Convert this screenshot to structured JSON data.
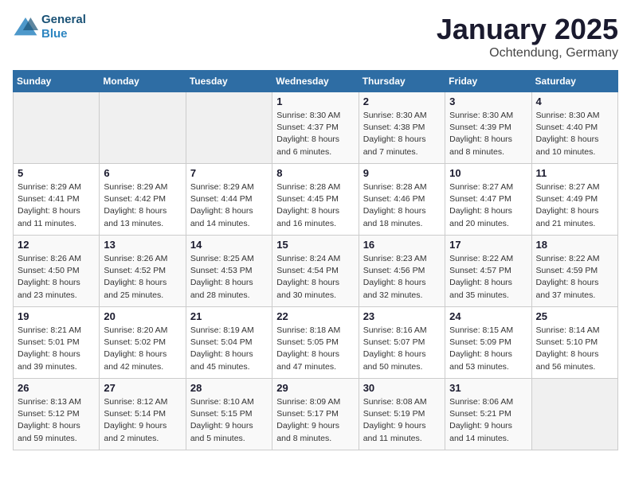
{
  "header": {
    "logo_line1": "General",
    "logo_line2": "Blue",
    "month": "January 2025",
    "location": "Ochtendung, Germany"
  },
  "weekdays": [
    "Sunday",
    "Monday",
    "Tuesday",
    "Wednesday",
    "Thursday",
    "Friday",
    "Saturday"
  ],
  "weeks": [
    [
      {
        "day": "",
        "detail": ""
      },
      {
        "day": "",
        "detail": ""
      },
      {
        "day": "",
        "detail": ""
      },
      {
        "day": "1",
        "detail": "Sunrise: 8:30 AM\nSunset: 4:37 PM\nDaylight: 8 hours\nand 6 minutes."
      },
      {
        "day": "2",
        "detail": "Sunrise: 8:30 AM\nSunset: 4:38 PM\nDaylight: 8 hours\nand 7 minutes."
      },
      {
        "day": "3",
        "detail": "Sunrise: 8:30 AM\nSunset: 4:39 PM\nDaylight: 8 hours\nand 8 minutes."
      },
      {
        "day": "4",
        "detail": "Sunrise: 8:30 AM\nSunset: 4:40 PM\nDaylight: 8 hours\nand 10 minutes."
      }
    ],
    [
      {
        "day": "5",
        "detail": "Sunrise: 8:29 AM\nSunset: 4:41 PM\nDaylight: 8 hours\nand 11 minutes."
      },
      {
        "day": "6",
        "detail": "Sunrise: 8:29 AM\nSunset: 4:42 PM\nDaylight: 8 hours\nand 13 minutes."
      },
      {
        "day": "7",
        "detail": "Sunrise: 8:29 AM\nSunset: 4:44 PM\nDaylight: 8 hours\nand 14 minutes."
      },
      {
        "day": "8",
        "detail": "Sunrise: 8:28 AM\nSunset: 4:45 PM\nDaylight: 8 hours\nand 16 minutes."
      },
      {
        "day": "9",
        "detail": "Sunrise: 8:28 AM\nSunset: 4:46 PM\nDaylight: 8 hours\nand 18 minutes."
      },
      {
        "day": "10",
        "detail": "Sunrise: 8:27 AM\nSunset: 4:47 PM\nDaylight: 8 hours\nand 20 minutes."
      },
      {
        "day": "11",
        "detail": "Sunrise: 8:27 AM\nSunset: 4:49 PM\nDaylight: 8 hours\nand 21 minutes."
      }
    ],
    [
      {
        "day": "12",
        "detail": "Sunrise: 8:26 AM\nSunset: 4:50 PM\nDaylight: 8 hours\nand 23 minutes."
      },
      {
        "day": "13",
        "detail": "Sunrise: 8:26 AM\nSunset: 4:52 PM\nDaylight: 8 hours\nand 25 minutes."
      },
      {
        "day": "14",
        "detail": "Sunrise: 8:25 AM\nSunset: 4:53 PM\nDaylight: 8 hours\nand 28 minutes."
      },
      {
        "day": "15",
        "detail": "Sunrise: 8:24 AM\nSunset: 4:54 PM\nDaylight: 8 hours\nand 30 minutes."
      },
      {
        "day": "16",
        "detail": "Sunrise: 8:23 AM\nSunset: 4:56 PM\nDaylight: 8 hours\nand 32 minutes."
      },
      {
        "day": "17",
        "detail": "Sunrise: 8:22 AM\nSunset: 4:57 PM\nDaylight: 8 hours\nand 35 minutes."
      },
      {
        "day": "18",
        "detail": "Sunrise: 8:22 AM\nSunset: 4:59 PM\nDaylight: 8 hours\nand 37 minutes."
      }
    ],
    [
      {
        "day": "19",
        "detail": "Sunrise: 8:21 AM\nSunset: 5:01 PM\nDaylight: 8 hours\nand 39 minutes."
      },
      {
        "day": "20",
        "detail": "Sunrise: 8:20 AM\nSunset: 5:02 PM\nDaylight: 8 hours\nand 42 minutes."
      },
      {
        "day": "21",
        "detail": "Sunrise: 8:19 AM\nSunset: 5:04 PM\nDaylight: 8 hours\nand 45 minutes."
      },
      {
        "day": "22",
        "detail": "Sunrise: 8:18 AM\nSunset: 5:05 PM\nDaylight: 8 hours\nand 47 minutes."
      },
      {
        "day": "23",
        "detail": "Sunrise: 8:16 AM\nSunset: 5:07 PM\nDaylight: 8 hours\nand 50 minutes."
      },
      {
        "day": "24",
        "detail": "Sunrise: 8:15 AM\nSunset: 5:09 PM\nDaylight: 8 hours\nand 53 minutes."
      },
      {
        "day": "25",
        "detail": "Sunrise: 8:14 AM\nSunset: 5:10 PM\nDaylight: 8 hours\nand 56 minutes."
      }
    ],
    [
      {
        "day": "26",
        "detail": "Sunrise: 8:13 AM\nSunset: 5:12 PM\nDaylight: 8 hours\nand 59 minutes."
      },
      {
        "day": "27",
        "detail": "Sunrise: 8:12 AM\nSunset: 5:14 PM\nDaylight: 9 hours\nand 2 minutes."
      },
      {
        "day": "28",
        "detail": "Sunrise: 8:10 AM\nSunset: 5:15 PM\nDaylight: 9 hours\nand 5 minutes."
      },
      {
        "day": "29",
        "detail": "Sunrise: 8:09 AM\nSunset: 5:17 PM\nDaylight: 9 hours\nand 8 minutes."
      },
      {
        "day": "30",
        "detail": "Sunrise: 8:08 AM\nSunset: 5:19 PM\nDaylight: 9 hours\nand 11 minutes."
      },
      {
        "day": "31",
        "detail": "Sunrise: 8:06 AM\nSunset: 5:21 PM\nDaylight: 9 hours\nand 14 minutes."
      },
      {
        "day": "",
        "detail": ""
      }
    ]
  ]
}
